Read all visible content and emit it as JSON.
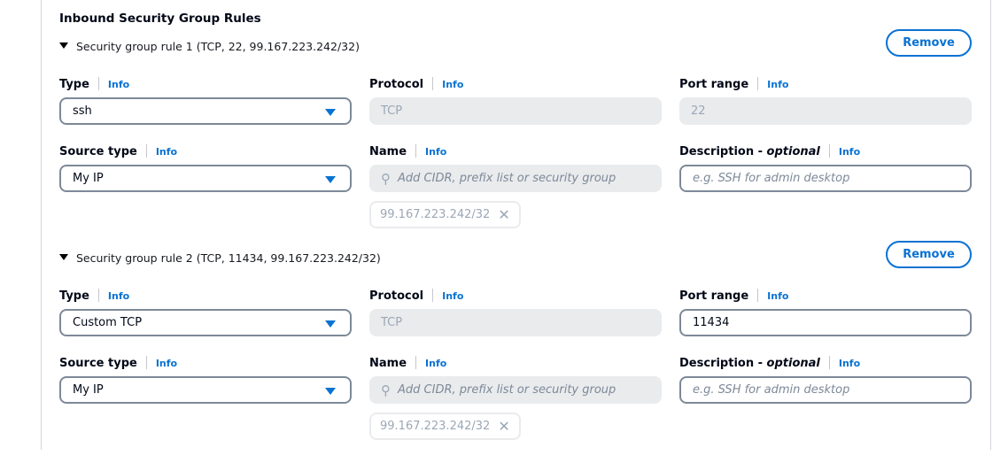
{
  "title": "Inbound Security Group Rules",
  "info": "Info",
  "labels": {
    "type": "Type",
    "protocol": "Protocol",
    "port_range": "Port range",
    "source_type": "Source type",
    "name": "Name",
    "description": "Description - ",
    "optional": "optional"
  },
  "remove_label": "Remove",
  "name_placeholder": "Add CIDR, prefix list or security group",
  "description_placeholder": "e.g. SSH for admin desktop",
  "rules": [
    {
      "header": "Security group rule 1 (TCP, 22, 99.167.223.242/32)",
      "type": "ssh",
      "protocol": "TCP",
      "port_range": "22",
      "port_editable": false,
      "source_type": "My IP",
      "cidr": "99.167.223.242/32"
    },
    {
      "header": "Security group rule 2 (TCP, 11434, 99.167.223.242/32)",
      "type": "Custom TCP",
      "protocol": "TCP",
      "port_range": "11434",
      "port_editable": true,
      "source_type": "My IP",
      "cidr": "99.167.223.242/32"
    }
  ]
}
